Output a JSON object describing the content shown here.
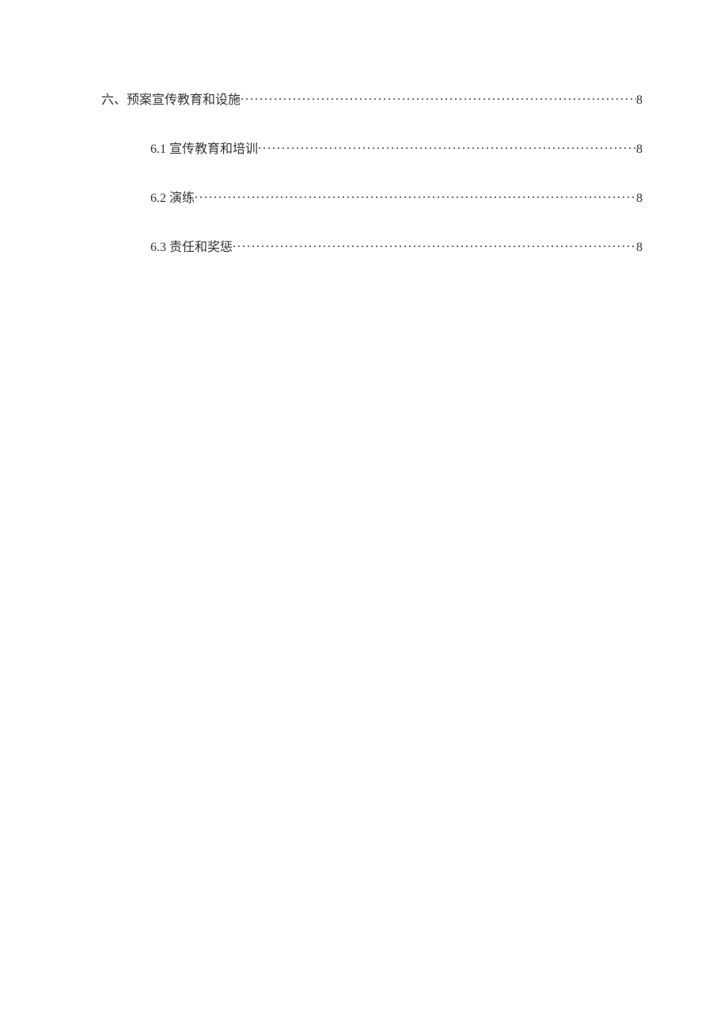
{
  "toc": {
    "section": {
      "label": "六、预案宣传教育和设施",
      "page": "8"
    },
    "subsections": [
      {
        "label": "6.1 宣传教育和培训",
        "page": "8"
      },
      {
        "label": "6.2 演练 ",
        "page": "8"
      },
      {
        "label": "6.3 责任和奖惩 ",
        "page": "8"
      }
    ]
  }
}
